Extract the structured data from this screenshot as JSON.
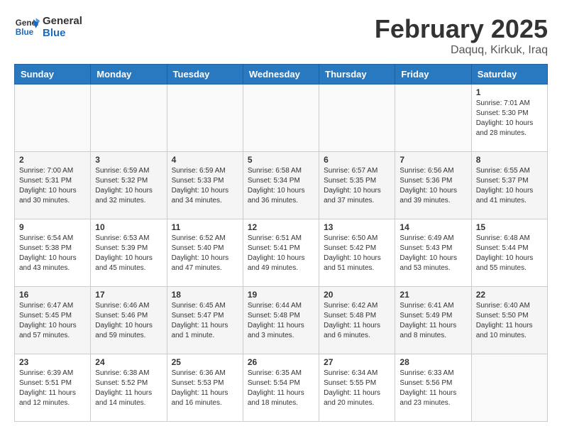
{
  "logo": {
    "line1": "General",
    "line2": "Blue"
  },
  "title": "February 2025",
  "location": "Daquq, Kirkuk, Iraq",
  "days_of_week": [
    "Sunday",
    "Monday",
    "Tuesday",
    "Wednesday",
    "Thursday",
    "Friday",
    "Saturday"
  ],
  "weeks": [
    [
      {
        "day": "",
        "info": ""
      },
      {
        "day": "",
        "info": ""
      },
      {
        "day": "",
        "info": ""
      },
      {
        "day": "",
        "info": ""
      },
      {
        "day": "",
        "info": ""
      },
      {
        "day": "",
        "info": ""
      },
      {
        "day": "1",
        "info": "Sunrise: 7:01 AM\nSunset: 5:30 PM\nDaylight: 10 hours\nand 28 minutes."
      }
    ],
    [
      {
        "day": "2",
        "info": "Sunrise: 7:00 AM\nSunset: 5:31 PM\nDaylight: 10 hours\nand 30 minutes."
      },
      {
        "day": "3",
        "info": "Sunrise: 6:59 AM\nSunset: 5:32 PM\nDaylight: 10 hours\nand 32 minutes."
      },
      {
        "day": "4",
        "info": "Sunrise: 6:59 AM\nSunset: 5:33 PM\nDaylight: 10 hours\nand 34 minutes."
      },
      {
        "day": "5",
        "info": "Sunrise: 6:58 AM\nSunset: 5:34 PM\nDaylight: 10 hours\nand 36 minutes."
      },
      {
        "day": "6",
        "info": "Sunrise: 6:57 AM\nSunset: 5:35 PM\nDaylight: 10 hours\nand 37 minutes."
      },
      {
        "day": "7",
        "info": "Sunrise: 6:56 AM\nSunset: 5:36 PM\nDaylight: 10 hours\nand 39 minutes."
      },
      {
        "day": "8",
        "info": "Sunrise: 6:55 AM\nSunset: 5:37 PM\nDaylight: 10 hours\nand 41 minutes."
      }
    ],
    [
      {
        "day": "9",
        "info": "Sunrise: 6:54 AM\nSunset: 5:38 PM\nDaylight: 10 hours\nand 43 minutes."
      },
      {
        "day": "10",
        "info": "Sunrise: 6:53 AM\nSunset: 5:39 PM\nDaylight: 10 hours\nand 45 minutes."
      },
      {
        "day": "11",
        "info": "Sunrise: 6:52 AM\nSunset: 5:40 PM\nDaylight: 10 hours\nand 47 minutes."
      },
      {
        "day": "12",
        "info": "Sunrise: 6:51 AM\nSunset: 5:41 PM\nDaylight: 10 hours\nand 49 minutes."
      },
      {
        "day": "13",
        "info": "Sunrise: 6:50 AM\nSunset: 5:42 PM\nDaylight: 10 hours\nand 51 minutes."
      },
      {
        "day": "14",
        "info": "Sunrise: 6:49 AM\nSunset: 5:43 PM\nDaylight: 10 hours\nand 53 minutes."
      },
      {
        "day": "15",
        "info": "Sunrise: 6:48 AM\nSunset: 5:44 PM\nDaylight: 10 hours\nand 55 minutes."
      }
    ],
    [
      {
        "day": "16",
        "info": "Sunrise: 6:47 AM\nSunset: 5:45 PM\nDaylight: 10 hours\nand 57 minutes."
      },
      {
        "day": "17",
        "info": "Sunrise: 6:46 AM\nSunset: 5:46 PM\nDaylight: 10 hours\nand 59 minutes."
      },
      {
        "day": "18",
        "info": "Sunrise: 6:45 AM\nSunset: 5:47 PM\nDaylight: 11 hours\nand 1 minute."
      },
      {
        "day": "19",
        "info": "Sunrise: 6:44 AM\nSunset: 5:48 PM\nDaylight: 11 hours\nand 3 minutes."
      },
      {
        "day": "20",
        "info": "Sunrise: 6:42 AM\nSunset: 5:48 PM\nDaylight: 11 hours\nand 6 minutes."
      },
      {
        "day": "21",
        "info": "Sunrise: 6:41 AM\nSunset: 5:49 PM\nDaylight: 11 hours\nand 8 minutes."
      },
      {
        "day": "22",
        "info": "Sunrise: 6:40 AM\nSunset: 5:50 PM\nDaylight: 11 hours\nand 10 minutes."
      }
    ],
    [
      {
        "day": "23",
        "info": "Sunrise: 6:39 AM\nSunset: 5:51 PM\nDaylight: 11 hours\nand 12 minutes."
      },
      {
        "day": "24",
        "info": "Sunrise: 6:38 AM\nSunset: 5:52 PM\nDaylight: 11 hours\nand 14 minutes."
      },
      {
        "day": "25",
        "info": "Sunrise: 6:36 AM\nSunset: 5:53 PM\nDaylight: 11 hours\nand 16 minutes."
      },
      {
        "day": "26",
        "info": "Sunrise: 6:35 AM\nSunset: 5:54 PM\nDaylight: 11 hours\nand 18 minutes."
      },
      {
        "day": "27",
        "info": "Sunrise: 6:34 AM\nSunset: 5:55 PM\nDaylight: 11 hours\nand 20 minutes."
      },
      {
        "day": "28",
        "info": "Sunrise: 6:33 AM\nSunset: 5:56 PM\nDaylight: 11 hours\nand 23 minutes."
      },
      {
        "day": "",
        "info": ""
      }
    ]
  ]
}
